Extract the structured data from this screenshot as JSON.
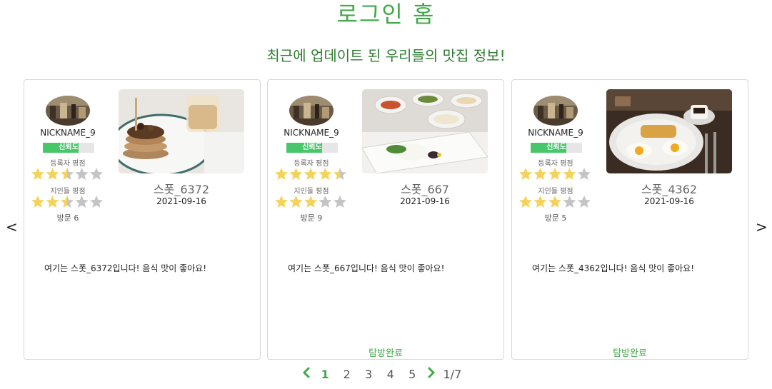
{
  "header": {
    "title": "로그인 홈",
    "subtitle": "최근에 업데이트 된 우리들의 맛집 정보!"
  },
  "carousel": {
    "prev_label": "<",
    "next_label": ">"
  },
  "cards": [
    {
      "nickname": "NICKNAME_9",
      "trust_label": "신뢰도",
      "trust_fraction": 0.7,
      "owner_rating_label": "등록자 평점",
      "owner_rating": 2.5,
      "friends_rating_label": "지인들 평점",
      "friends_rating": 2.5,
      "visits_text": "방문 6",
      "spot_name": "스폿_6372",
      "date": "2021-09-16",
      "description": "여기는 스폿_6372입니다! 음식 맛이 좋아요!",
      "visited_label": ""
    },
    {
      "nickname": "NICKNAME_9",
      "trust_label": "신뢰도",
      "trust_fraction": 0.7,
      "owner_rating_label": "등록자 평점",
      "owner_rating": 4.5,
      "friends_rating_label": "지인들 평점",
      "friends_rating": 3,
      "visits_text": "방문 9",
      "spot_name": "스폿_667",
      "date": "2021-09-16",
      "description": "여기는 스폿_667입니다! 음식 맛이 좋아요!",
      "visited_label": "탐방완료"
    },
    {
      "nickname": "NICKNAME_9",
      "trust_label": "신뢰도",
      "trust_fraction": 0.7,
      "owner_rating_label": "등록자 평점",
      "owner_rating": 4,
      "friends_rating_label": "지인들 평점",
      "friends_rating": 3,
      "visits_text": "방문 5",
      "spot_name": "스폿_4362",
      "date": "2021-09-16",
      "description": "여기는 스폿_4362입니다! 음식 맛이 좋아요!",
      "visited_label": "탐방완료"
    }
  ],
  "pagination": {
    "pages": [
      "1",
      "2",
      "3",
      "4",
      "5"
    ],
    "active": "1",
    "info": "1/7"
  },
  "colors": {
    "accent": "#43a84a",
    "star_filled": "#f5d35a",
    "star_empty": "#c4c4c4",
    "trust": "#47c76a"
  },
  "icons": {
    "pagination_prev": "chevron-left-icon",
    "pagination_next": "chevron-right-icon",
    "rating": "star-icon"
  }
}
